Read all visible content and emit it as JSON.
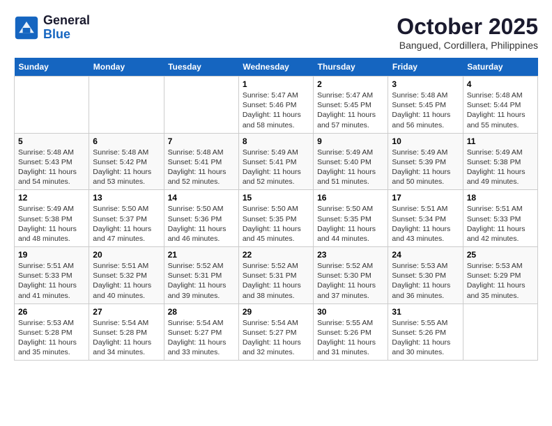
{
  "header": {
    "logo_line1": "General",
    "logo_line2": "Blue",
    "month": "October 2025",
    "location": "Bangued, Cordillera, Philippines"
  },
  "days_of_week": [
    "Sunday",
    "Monday",
    "Tuesday",
    "Wednesday",
    "Thursday",
    "Friday",
    "Saturday"
  ],
  "weeks": [
    [
      {
        "day": "",
        "sunrise": "",
        "sunset": "",
        "daylight": ""
      },
      {
        "day": "",
        "sunrise": "",
        "sunset": "",
        "daylight": ""
      },
      {
        "day": "",
        "sunrise": "",
        "sunset": "",
        "daylight": ""
      },
      {
        "day": "1",
        "sunrise": "Sunrise: 5:47 AM",
        "sunset": "Sunset: 5:46 PM",
        "daylight": "Daylight: 11 hours and 58 minutes."
      },
      {
        "day": "2",
        "sunrise": "Sunrise: 5:47 AM",
        "sunset": "Sunset: 5:45 PM",
        "daylight": "Daylight: 11 hours and 57 minutes."
      },
      {
        "day": "3",
        "sunrise": "Sunrise: 5:48 AM",
        "sunset": "Sunset: 5:45 PM",
        "daylight": "Daylight: 11 hours and 56 minutes."
      },
      {
        "day": "4",
        "sunrise": "Sunrise: 5:48 AM",
        "sunset": "Sunset: 5:44 PM",
        "daylight": "Daylight: 11 hours and 55 minutes."
      }
    ],
    [
      {
        "day": "5",
        "sunrise": "Sunrise: 5:48 AM",
        "sunset": "Sunset: 5:43 PM",
        "daylight": "Daylight: 11 hours and 54 minutes."
      },
      {
        "day": "6",
        "sunrise": "Sunrise: 5:48 AM",
        "sunset": "Sunset: 5:42 PM",
        "daylight": "Daylight: 11 hours and 53 minutes."
      },
      {
        "day": "7",
        "sunrise": "Sunrise: 5:48 AM",
        "sunset": "Sunset: 5:41 PM",
        "daylight": "Daylight: 11 hours and 52 minutes."
      },
      {
        "day": "8",
        "sunrise": "Sunrise: 5:49 AM",
        "sunset": "Sunset: 5:41 PM",
        "daylight": "Daylight: 11 hours and 52 minutes."
      },
      {
        "day": "9",
        "sunrise": "Sunrise: 5:49 AM",
        "sunset": "Sunset: 5:40 PM",
        "daylight": "Daylight: 11 hours and 51 minutes."
      },
      {
        "day": "10",
        "sunrise": "Sunrise: 5:49 AM",
        "sunset": "Sunset: 5:39 PM",
        "daylight": "Daylight: 11 hours and 50 minutes."
      },
      {
        "day": "11",
        "sunrise": "Sunrise: 5:49 AM",
        "sunset": "Sunset: 5:38 PM",
        "daylight": "Daylight: 11 hours and 49 minutes."
      }
    ],
    [
      {
        "day": "12",
        "sunrise": "Sunrise: 5:49 AM",
        "sunset": "Sunset: 5:38 PM",
        "daylight": "Daylight: 11 hours and 48 minutes."
      },
      {
        "day": "13",
        "sunrise": "Sunrise: 5:50 AM",
        "sunset": "Sunset: 5:37 PM",
        "daylight": "Daylight: 11 hours and 47 minutes."
      },
      {
        "day": "14",
        "sunrise": "Sunrise: 5:50 AM",
        "sunset": "Sunset: 5:36 PM",
        "daylight": "Daylight: 11 hours and 46 minutes."
      },
      {
        "day": "15",
        "sunrise": "Sunrise: 5:50 AM",
        "sunset": "Sunset: 5:35 PM",
        "daylight": "Daylight: 11 hours and 45 minutes."
      },
      {
        "day": "16",
        "sunrise": "Sunrise: 5:50 AM",
        "sunset": "Sunset: 5:35 PM",
        "daylight": "Daylight: 11 hours and 44 minutes."
      },
      {
        "day": "17",
        "sunrise": "Sunrise: 5:51 AM",
        "sunset": "Sunset: 5:34 PM",
        "daylight": "Daylight: 11 hours and 43 minutes."
      },
      {
        "day": "18",
        "sunrise": "Sunrise: 5:51 AM",
        "sunset": "Sunset: 5:33 PM",
        "daylight": "Daylight: 11 hours and 42 minutes."
      }
    ],
    [
      {
        "day": "19",
        "sunrise": "Sunrise: 5:51 AM",
        "sunset": "Sunset: 5:33 PM",
        "daylight": "Daylight: 11 hours and 41 minutes."
      },
      {
        "day": "20",
        "sunrise": "Sunrise: 5:51 AM",
        "sunset": "Sunset: 5:32 PM",
        "daylight": "Daylight: 11 hours and 40 minutes."
      },
      {
        "day": "21",
        "sunrise": "Sunrise: 5:52 AM",
        "sunset": "Sunset: 5:31 PM",
        "daylight": "Daylight: 11 hours and 39 minutes."
      },
      {
        "day": "22",
        "sunrise": "Sunrise: 5:52 AM",
        "sunset": "Sunset: 5:31 PM",
        "daylight": "Daylight: 11 hours and 38 minutes."
      },
      {
        "day": "23",
        "sunrise": "Sunrise: 5:52 AM",
        "sunset": "Sunset: 5:30 PM",
        "daylight": "Daylight: 11 hours and 37 minutes."
      },
      {
        "day": "24",
        "sunrise": "Sunrise: 5:53 AM",
        "sunset": "Sunset: 5:30 PM",
        "daylight": "Daylight: 11 hours and 36 minutes."
      },
      {
        "day": "25",
        "sunrise": "Sunrise: 5:53 AM",
        "sunset": "Sunset: 5:29 PM",
        "daylight": "Daylight: 11 hours and 35 minutes."
      }
    ],
    [
      {
        "day": "26",
        "sunrise": "Sunrise: 5:53 AM",
        "sunset": "Sunset: 5:28 PM",
        "daylight": "Daylight: 11 hours and 35 minutes."
      },
      {
        "day": "27",
        "sunrise": "Sunrise: 5:54 AM",
        "sunset": "Sunset: 5:28 PM",
        "daylight": "Daylight: 11 hours and 34 minutes."
      },
      {
        "day": "28",
        "sunrise": "Sunrise: 5:54 AM",
        "sunset": "Sunset: 5:27 PM",
        "daylight": "Daylight: 11 hours and 33 minutes."
      },
      {
        "day": "29",
        "sunrise": "Sunrise: 5:54 AM",
        "sunset": "Sunset: 5:27 PM",
        "daylight": "Daylight: 11 hours and 32 minutes."
      },
      {
        "day": "30",
        "sunrise": "Sunrise: 5:55 AM",
        "sunset": "Sunset: 5:26 PM",
        "daylight": "Daylight: 11 hours and 31 minutes."
      },
      {
        "day": "31",
        "sunrise": "Sunrise: 5:55 AM",
        "sunset": "Sunset: 5:26 PM",
        "daylight": "Daylight: 11 hours and 30 minutes."
      },
      {
        "day": "",
        "sunrise": "",
        "sunset": "",
        "daylight": ""
      }
    ]
  ]
}
